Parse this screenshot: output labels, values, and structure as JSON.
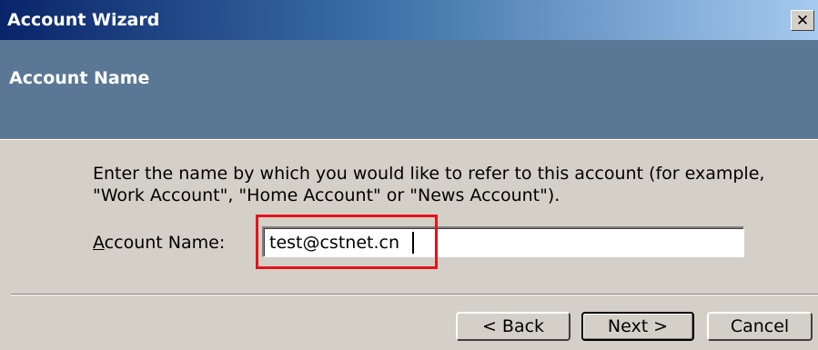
{
  "window": {
    "title": "Account Wizard",
    "close_glyph": "✕"
  },
  "header": {
    "title": "Account Name"
  },
  "body": {
    "description": "Enter the name by which you would like to refer to this account (for example, \"Work Account\", \"Home Account\" or \"News Account\").",
    "field_label_first": "A",
    "field_label_rest": "ccount Name:",
    "field_value": "test@cstnet.cn"
  },
  "buttons": {
    "back": "< Back",
    "next": "Next >",
    "cancel": "Cancel"
  },
  "colors": {
    "header_band": "#5a7895",
    "highlight": "#e4141a",
    "title_gradient_start": "#0a246a"
  }
}
